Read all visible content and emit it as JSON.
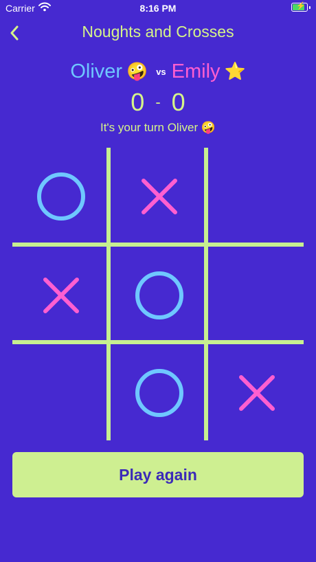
{
  "status_bar": {
    "carrier": "Carrier",
    "time": "8:16 PM"
  },
  "nav": {
    "back_icon": "chevron-left-icon",
    "title": "Noughts and Crosses"
  },
  "players": {
    "player1": {
      "name": "Oliver",
      "emoji": "🤪",
      "color": "#6fc7ff"
    },
    "vs_label": "vs",
    "player2": {
      "name": "Emily",
      "emoji": "⭐",
      "color": "#ff5fd0"
    }
  },
  "score": {
    "player1": "0",
    "separator": "-",
    "player2": "0"
  },
  "turn_message": "It's your turn Oliver 🤪",
  "board": {
    "cells": [
      "O",
      "X",
      "",
      "X",
      "O",
      "",
      "",
      "O",
      "X"
    ]
  },
  "colors": {
    "background": "#4629d0",
    "accent": "#d6f48a",
    "grid": "#c7ef91",
    "nought": "#6fc7ff",
    "cross": "#ff5fd0",
    "button_bg": "#ceef91",
    "button_text": "#3b2ab8"
  },
  "play_again_label": "Play again"
}
